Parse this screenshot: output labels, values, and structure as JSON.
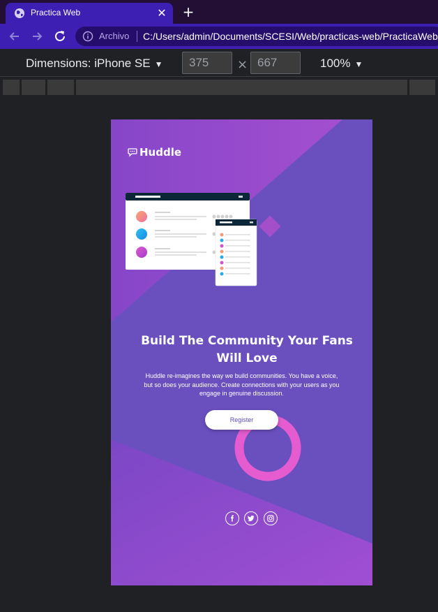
{
  "browser": {
    "tab_title": "Practica Web",
    "tab_close": "✕",
    "new_tab": "+",
    "address_label": "Archivo",
    "url": "C:/Users/admin/Documents/SCESI/Web/practicas-web/PracticaWeb.h"
  },
  "devtools": {
    "dimensions_label": "Dimensions: iPhone SE",
    "width": "375",
    "height": "667",
    "times": "×",
    "zoom": "100%"
  },
  "page": {
    "logo": "Huddle",
    "headline": "Build The Community Your Fans Will Love",
    "description": "Huddle re-imagines the way we build communities. You have a voice, but so does your audience. Create connections with your users as you engage in genuine discussion.",
    "register_label": "Register",
    "socials": [
      "facebook-icon",
      "twitter-icon",
      "instagram-icon"
    ]
  },
  "colors": {
    "tab_active": "#3d1fb4",
    "page_violet": "#6d4fc2",
    "page_pink": "#c84fd0",
    "ring_pink": "#e65ccf"
  }
}
